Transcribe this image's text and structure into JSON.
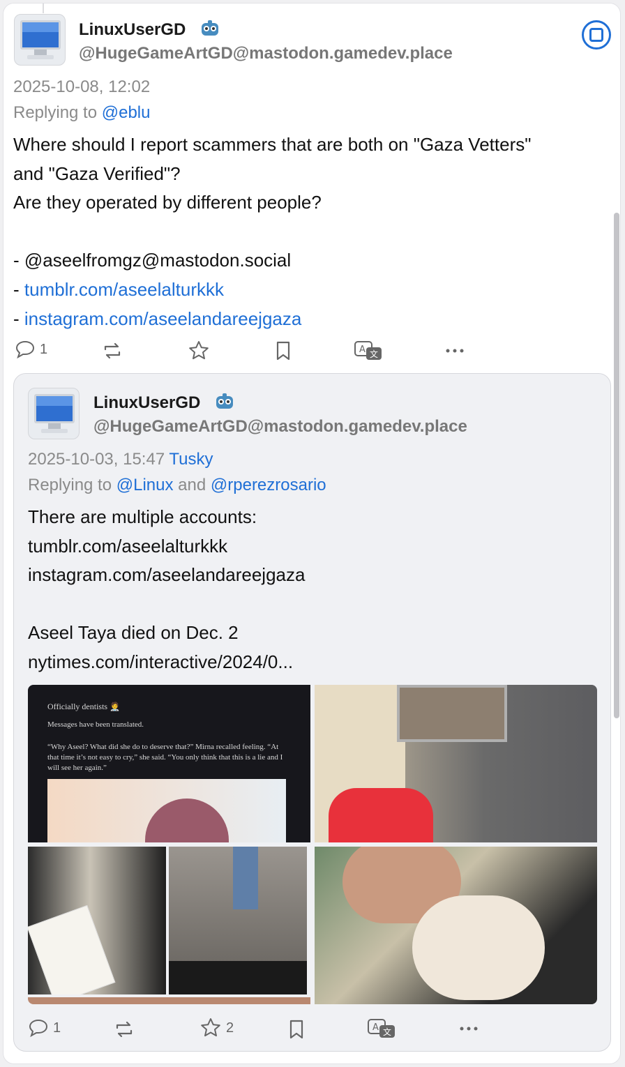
{
  "post": {
    "display_name": "LinuxUserGD",
    "handle": "@HugeGameArtGD@mastodon.gamedev.place",
    "timestamp": "2025-10-08, 12:02",
    "reply_prefix": "Replying to",
    "reply_to": "@eblu",
    "body_lines": [
      "Where should I report scammers that are both on \"Gaza Vetters\"",
      "and \"Gaza Verified\"?",
      "Are they operated by different people?",
      "- @aseelfromgz@mastodon.social"
    ],
    "link_prefix": "- ",
    "links": [
      "tumblr.com/aseelalturkkk",
      "instagram.com/aseelandareejgaza"
    ],
    "actions": {
      "reply_count": "1",
      "boost_count": "",
      "favourite_count": ""
    }
  },
  "quote": {
    "display_name": "LinuxUserGD",
    "handle": "@HugeGameArtGD@mastodon.gamedev.place",
    "timestamp": "2025-10-03, 15:47",
    "client": "Tusky",
    "reply_prefix": "Replying to",
    "reply_to_1": "@Linux",
    "reply_and": "and",
    "reply_to_2": "@rperezrosario",
    "body_line_1": "There are multiple accounts:",
    "links": [
      "tumblr.com/aseelalturkkk",
      "instagram.com/aseelandareejgaza"
    ],
    "body_line_2": "Aseel Taya died on Dec. 2",
    "news_link": "nytimes.com/interactive/2024/0...",
    "media_text": {
      "title": "Officially dentists 🧑‍⚕️",
      "note": "Messages have been translated.",
      "quote_1": "“Why Aseel? What did she do to deserve that?” Mirna recalled feeling. “At",
      "quote_2": "that time it’s not easy to cry,” she said. “You only think that this is a lie and I",
      "quote_3": "will see her again.”"
    },
    "actions": {
      "reply_count": "1",
      "boost_count": "",
      "favourite_count": "2"
    }
  },
  "colors": {
    "link": "#1f6fd6",
    "meta": "#8a8a8a",
    "quote_bg": "#f0f1f4"
  },
  "icons": [
    "reply-icon",
    "boost-icon",
    "favourite-icon",
    "bookmark-icon",
    "translate-icon",
    "more-icon",
    "bot-icon",
    "menu-icon"
  ]
}
